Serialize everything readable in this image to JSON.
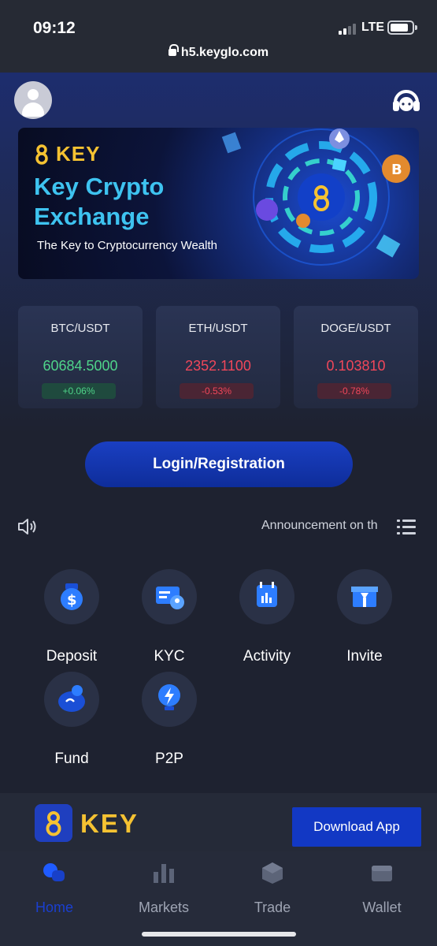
{
  "status_bar": {
    "time": "09:12",
    "network": "LTE",
    "url": "h5.keyglo.com"
  },
  "header": {
    "avatar_icon": "user-avatar-icon",
    "support_icon": "customer-support-headset-icon"
  },
  "banner": {
    "logo_text": "KEY",
    "title_line1": "Key Crypto",
    "title_line2": "Exchange",
    "subtitle": "The Key to Cryptocurrency Wealth"
  },
  "tickers": [
    {
      "pair": "BTC/USDT",
      "price": "60684.5000",
      "change": "+0.06%",
      "direction": "up"
    },
    {
      "pair": "ETH/USDT",
      "price": "2352.1100",
      "change": "-0.53%",
      "direction": "down"
    },
    {
      "pair": "DOGE/USDT",
      "price": "0.103810",
      "change": "-0.78%",
      "direction": "down"
    }
  ],
  "login_button": "Login/Registration",
  "announcement": {
    "text": "Announcement on th",
    "speaker_icon": "speaker-icon",
    "list_icon": "list-icon"
  },
  "actions": [
    {
      "label": "Deposit",
      "icon": "dollar-coin-icon"
    },
    {
      "label": "KYC",
      "icon": "id-card-icon"
    },
    {
      "label": "Activity",
      "icon": "calendar-chart-icon"
    },
    {
      "label": "Invite",
      "icon": "gift-box-icon"
    },
    {
      "label": "Fund",
      "icon": "piggy-bank-icon"
    },
    {
      "label": "P2P",
      "icon": "lightning-bulb-icon"
    }
  ],
  "download_bar": {
    "logo_text": "KEY",
    "button": "Download App"
  },
  "tabs": [
    {
      "label": "Home",
      "icon": "home-icon",
      "active": true
    },
    {
      "label": "Markets",
      "icon": "bar-chart-icon",
      "active": false
    },
    {
      "label": "Trade",
      "icon": "cube-icon",
      "active": false
    },
    {
      "label": "Wallet",
      "icon": "wallet-icon",
      "active": false
    }
  ],
  "colors": {
    "accent": "#1a3fd0",
    "brand_yellow": "#f5c232",
    "up": "#4fd48a",
    "down": "#f0475a"
  }
}
